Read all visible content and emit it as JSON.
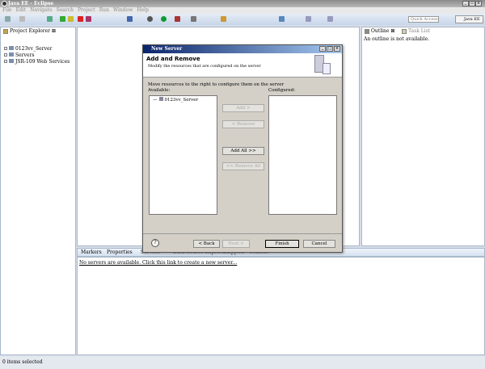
{
  "window": {
    "title": "Java EE - Eclipse"
  },
  "menu": [
    "File",
    "Edit",
    "Navigate",
    "Search",
    "Project",
    "Run",
    "Window",
    "Help"
  ],
  "toolbar": {
    "quick_access_placeholder": "Quick Access",
    "perspective": "Java EE"
  },
  "project_explorer": {
    "tab": "Project Explorer",
    "items": [
      "0123vv_Server",
      "Servers",
      "JSR-109 Web Services"
    ]
  },
  "outline": {
    "tabs": [
      "Outline",
      "Task List"
    ],
    "message": "An outline is not available."
  },
  "dialog": {
    "title": "New Server",
    "heading": "Add and Remove",
    "description": "Modify the resources that are configured on the server",
    "instruction": "Move resources to the right to configure them on the server",
    "available_label": "Available:",
    "configured_label": "Configured:",
    "available_items": [
      "0123vv_Server"
    ],
    "buttons": {
      "add": "Add >",
      "remove": "< Remove",
      "add_all": "Add All >>",
      "remove_all": "<< Remove All",
      "back": "< Back",
      "next": "Next >",
      "finish": "Finish",
      "cancel": "Cancel"
    }
  },
  "bottom": {
    "tabs": [
      "Markers",
      "Properties",
      "Servers",
      "Data Source Explorer",
      "Snippets",
      "Console"
    ],
    "link": "No servers are available. Click this link to create a new server..."
  },
  "status": {
    "text": "0 items selected"
  }
}
